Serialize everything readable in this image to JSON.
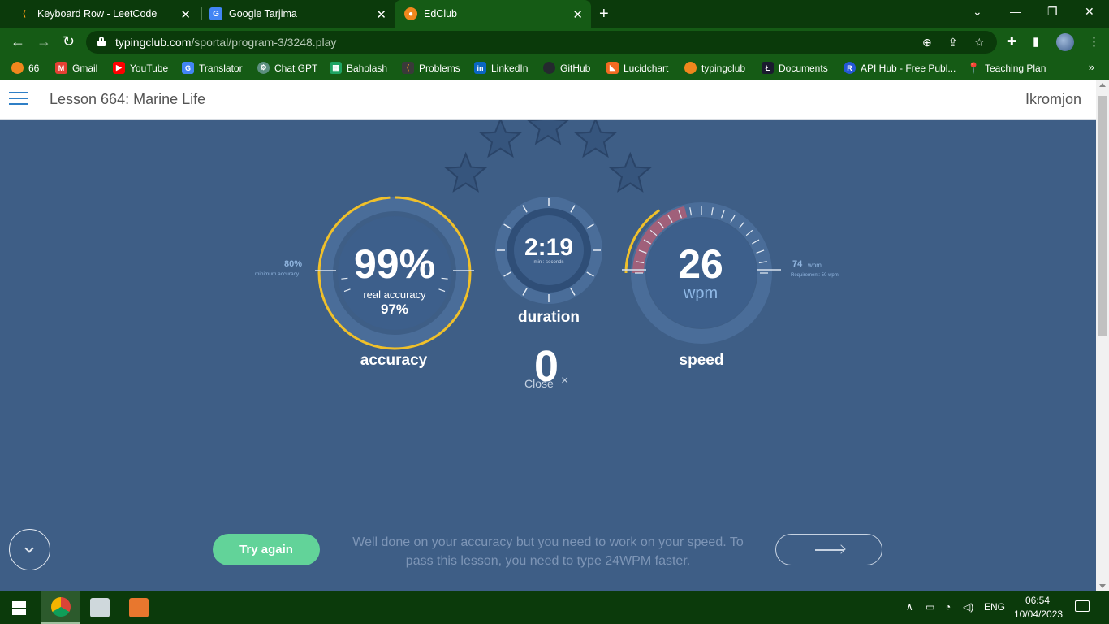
{
  "browser": {
    "tabs": [
      {
        "title": "Keyboard Row - LeetCode",
        "icon": "leetcode-icon",
        "active": false
      },
      {
        "title": "Google Tarjima",
        "icon": "google-translate-icon",
        "active": false
      },
      {
        "title": "EdClub",
        "icon": "edclub-icon",
        "active": true
      }
    ],
    "url_host": "typingclub.com",
    "url_path": "/sportal/program-3/3248.play",
    "bookmarks": [
      {
        "label": "66",
        "icon": "typingclub-icon",
        "color": "#f0871d"
      },
      {
        "label": "Gmail",
        "icon": "gmail-icon",
        "color": "#e44134"
      },
      {
        "label": "YouTube",
        "icon": "youtube-icon",
        "color": "#ff0000"
      },
      {
        "label": "Translator",
        "icon": "google-translate-icon",
        "color": "#4285f4"
      },
      {
        "label": "Chat GPT",
        "icon": "chatgpt-icon",
        "color": "#5c8f7f"
      },
      {
        "label": "Baholash",
        "icon": "sheets-icon",
        "color": "#1fa463"
      },
      {
        "label": "Problems",
        "icon": "leetcode-icon",
        "color": "#ffa116"
      },
      {
        "label": "LinkedIn",
        "icon": "linkedin-icon",
        "color": "#0a66c2"
      },
      {
        "label": "GitHub",
        "icon": "github-icon",
        "color": "#24292e"
      },
      {
        "label": "Lucidchart",
        "icon": "lucidchart-icon",
        "color": "#f26b21"
      },
      {
        "label": "typingclub",
        "icon": "typingclub-icon",
        "color": "#f0871d"
      },
      {
        "label": "Documents",
        "icon": "documents-icon",
        "color": "#1b1b2f"
      },
      {
        "label": "API Hub - Free Publ...",
        "icon": "api-hub-icon",
        "color": "#2457d6"
      },
      {
        "label": "Teaching Plan",
        "icon": "pushpin-icon",
        "color": "#d9d9d9"
      }
    ]
  },
  "page": {
    "lesson_title": "Lesson 664: Marine Life",
    "username": "Ikromjon"
  },
  "results": {
    "stars_total": 5,
    "stars_earned": 0,
    "accuracy": {
      "value": "99%",
      "real_label": "real accuracy",
      "real_value": "97%",
      "label": "accuracy",
      "min_value": "80%",
      "min_label": "minimum accuracy",
      "fraction": 0.99
    },
    "duration": {
      "value": "2:19",
      "unit": "min : seconds",
      "label": "duration"
    },
    "speed": {
      "value": "26",
      "unit": "wpm",
      "label": "speed",
      "req_value": "74",
      "req_unit": "wpm",
      "req_label": "Requirement: 50 wpm",
      "fraction": 0.26
    },
    "center_counter": "0",
    "close_label": "Close",
    "try_again_label": "Try again",
    "feedback": "Well done on your accuracy but you need to work on your speed. To pass this lesson, you need to type 24WPM faster."
  },
  "taskbar": {
    "language": "ENG",
    "time": "06:54",
    "date": "10/04/2023"
  },
  "colors": {
    "background": "#3e5e86",
    "gauge_ring": "#4a6d99",
    "gauge_inner": "#3d5f8b",
    "accent_yellow": "#f0c02a",
    "speed_red": "#a0607a",
    "button_green": "#62d399",
    "browser_green": "#155b15"
  }
}
